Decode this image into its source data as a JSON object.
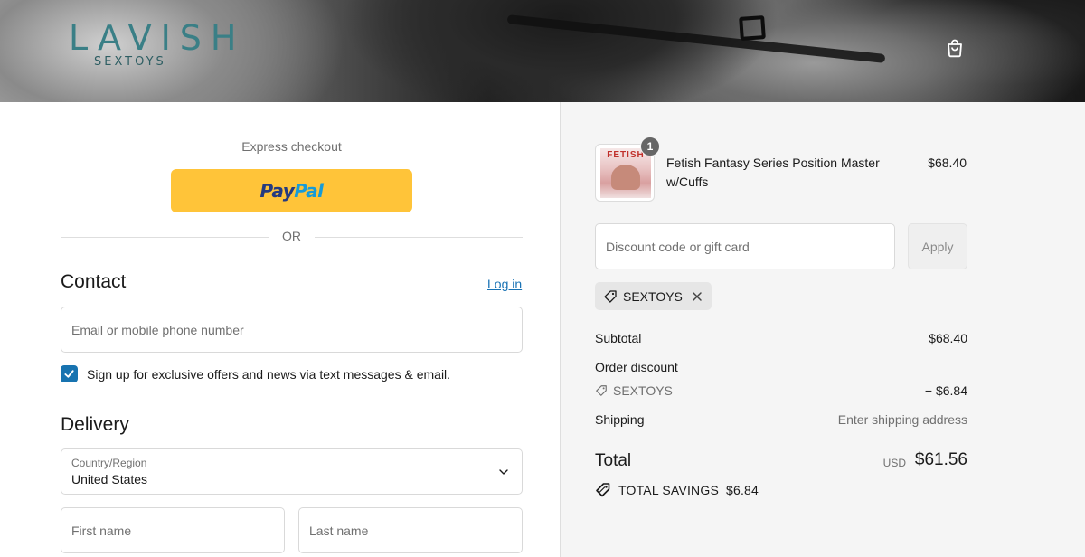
{
  "header": {
    "logo_main": "LAVISH",
    "logo_sub": "SEXTOYS",
    "cart_icon": "shopping-bag-icon"
  },
  "express": {
    "label": "Express checkout",
    "paypal_part1": "Pay",
    "paypal_part2": "Pal",
    "or_label": "OR"
  },
  "contact": {
    "heading": "Contact",
    "login_link": "Log in",
    "email_placeholder": "Email or mobile phone number",
    "email_value": "",
    "signup_checked": true,
    "signup_label": "Sign up for exclusive offers and news via text messages & email."
  },
  "delivery": {
    "heading": "Delivery",
    "country_label": "Country/Region",
    "country_value": "United States",
    "first_name_placeholder": "First name",
    "last_name_placeholder": "Last name"
  },
  "order": {
    "product": {
      "name": "Fetish Fantasy Series Position Master w/Cuffs",
      "price": "$68.40",
      "quantity": "1",
      "thumb_text": "FETISH"
    },
    "discount_placeholder": "Discount code or gift card",
    "apply_label": "Apply",
    "applied_code": "SEXTOYS",
    "subtotal_label": "Subtotal",
    "subtotal_value": "$68.40",
    "order_discount_label": "Order discount",
    "discount_code": "SEXTOYS",
    "discount_value": "− $6.84",
    "shipping_label": "Shipping",
    "shipping_value": "Enter shipping address",
    "total_label": "Total",
    "total_currency": "USD",
    "total_value": "$61.56",
    "savings_label": "TOTAL SAVINGS",
    "savings_value": "$6.84"
  },
  "colors": {
    "paypal_yellow": "#ffc439",
    "link_blue": "#1a73b5",
    "checkbox_blue": "#1773b0",
    "logo_teal": "#3a7f86",
    "summary_bg": "#f5f5f5"
  }
}
